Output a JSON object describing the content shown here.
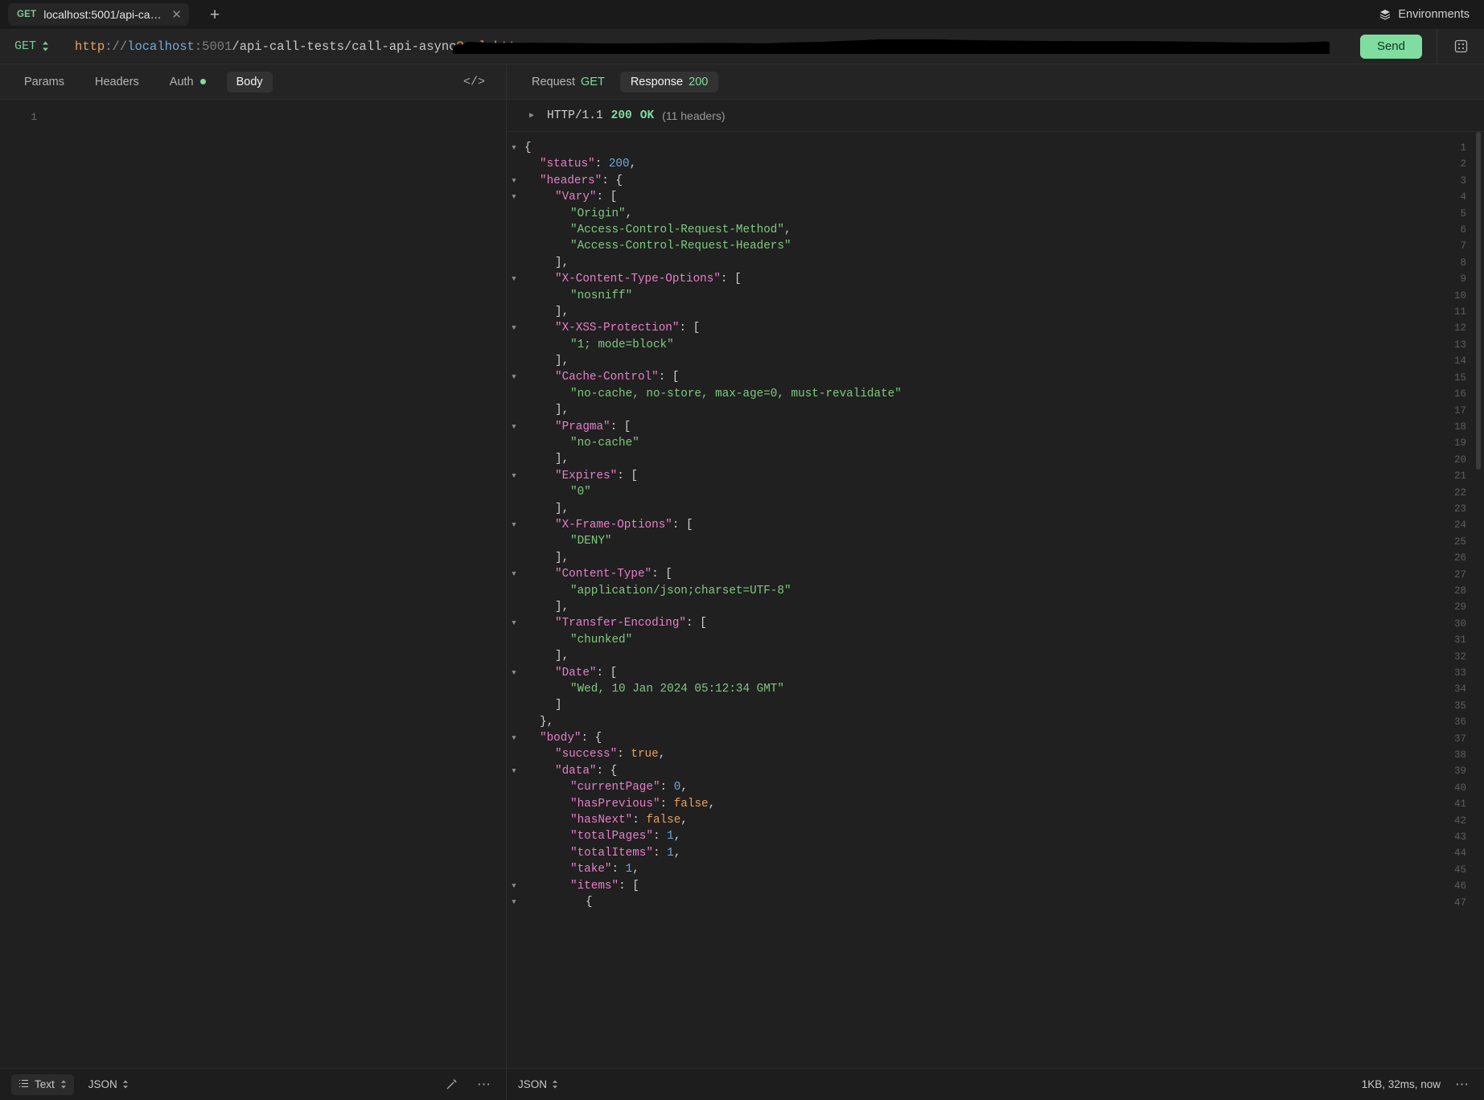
{
  "tabbar": {
    "request_tab": {
      "method": "GET",
      "name": "localhost:5001/api-cal…",
      "close_icon": "close-icon"
    },
    "new_tab_label": "+",
    "environments_label": "Environments"
  },
  "urlbar": {
    "method": "GET",
    "url_scheme": "http",
    "url_sep": "://",
    "url_host": "localhost",
    "url_colon": ":",
    "url_port": "5001",
    "url_path": "/api-call-tests/call-api-async",
    "url_query_mark": "?",
    "url_query_key": "url=",
    "url_query_value_visible": "http",
    "url_full": "http://localhost:5001/api-call-tests/call-api-async?url=http[redacted]",
    "send_label": "Send",
    "code_icon": "code-generate-icon"
  },
  "request_pane": {
    "tabs": [
      {
        "label": "Params",
        "active": false,
        "dot": false
      },
      {
        "label": "Headers",
        "active": false,
        "dot": false
      },
      {
        "label": "Auth",
        "active": false,
        "dot": true
      },
      {
        "label": "Body",
        "active": true,
        "dot": false
      }
    ],
    "code_icon_label": "</>",
    "editor_line_number": "1",
    "editor_content": ""
  },
  "response_pane": {
    "tabs": [
      {
        "label": "Request",
        "badge": "GET",
        "active": false
      },
      {
        "label": "Response",
        "badge": "200",
        "active": true
      }
    ],
    "status": {
      "twisty": "▶",
      "protocol": "HTTP/1.1",
      "code": "200",
      "text": "OK",
      "headers_count": "(11 headers)"
    }
  },
  "json_lines": [
    {
      "n": 1,
      "tw": "▼",
      "indent": 0,
      "parts": [
        {
          "t": "p",
          "v": "{"
        }
      ]
    },
    {
      "n": 2,
      "tw": "",
      "indent": 1,
      "parts": [
        {
          "t": "k",
          "v": "\"status\""
        },
        {
          "t": "p",
          "v": ": "
        },
        {
          "t": "n",
          "v": "200"
        },
        {
          "t": "p",
          "v": ","
        }
      ]
    },
    {
      "n": 3,
      "tw": "▼",
      "indent": 1,
      "parts": [
        {
          "t": "k",
          "v": "\"headers\""
        },
        {
          "t": "p",
          "v": ": {"
        }
      ]
    },
    {
      "n": 4,
      "tw": "▼",
      "indent": 2,
      "parts": [
        {
          "t": "k",
          "v": "\"Vary\""
        },
        {
          "t": "p",
          "v": ": ["
        }
      ]
    },
    {
      "n": 5,
      "tw": "",
      "indent": 3,
      "parts": [
        {
          "t": "s",
          "v": "\"Origin\""
        },
        {
          "t": "p",
          "v": ","
        }
      ]
    },
    {
      "n": 6,
      "tw": "",
      "indent": 3,
      "parts": [
        {
          "t": "s",
          "v": "\"Access-Control-Request-Method\""
        },
        {
          "t": "p",
          "v": ","
        }
      ]
    },
    {
      "n": 7,
      "tw": "",
      "indent": 3,
      "parts": [
        {
          "t": "s",
          "v": "\"Access-Control-Request-Headers\""
        }
      ]
    },
    {
      "n": 8,
      "tw": "",
      "indent": 2,
      "parts": [
        {
          "t": "p",
          "v": "],"
        }
      ]
    },
    {
      "n": 9,
      "tw": "▼",
      "indent": 2,
      "parts": [
        {
          "t": "k",
          "v": "\"X-Content-Type-Options\""
        },
        {
          "t": "p",
          "v": ": ["
        }
      ]
    },
    {
      "n": 10,
      "tw": "",
      "indent": 3,
      "parts": [
        {
          "t": "s",
          "v": "\"nosniff\""
        }
      ]
    },
    {
      "n": 11,
      "tw": "",
      "indent": 2,
      "parts": [
        {
          "t": "p",
          "v": "],"
        }
      ]
    },
    {
      "n": 12,
      "tw": "▼",
      "indent": 2,
      "parts": [
        {
          "t": "k",
          "v": "\"X-XSS-Protection\""
        },
        {
          "t": "p",
          "v": ": ["
        }
      ]
    },
    {
      "n": 13,
      "tw": "",
      "indent": 3,
      "parts": [
        {
          "t": "s",
          "v": "\"1; mode=block\""
        }
      ]
    },
    {
      "n": 14,
      "tw": "",
      "indent": 2,
      "parts": [
        {
          "t": "p",
          "v": "],"
        }
      ]
    },
    {
      "n": 15,
      "tw": "▼",
      "indent": 2,
      "parts": [
        {
          "t": "k",
          "v": "\"Cache-Control\""
        },
        {
          "t": "p",
          "v": ": ["
        }
      ]
    },
    {
      "n": 16,
      "tw": "",
      "indent": 3,
      "parts": [
        {
          "t": "s",
          "v": "\"no-cache, no-store, max-age=0, must-revalidate\""
        }
      ]
    },
    {
      "n": 17,
      "tw": "",
      "indent": 2,
      "parts": [
        {
          "t": "p",
          "v": "],"
        }
      ]
    },
    {
      "n": 18,
      "tw": "▼",
      "indent": 2,
      "parts": [
        {
          "t": "k",
          "v": "\"Pragma\""
        },
        {
          "t": "p",
          "v": ": ["
        }
      ]
    },
    {
      "n": 19,
      "tw": "",
      "indent": 3,
      "parts": [
        {
          "t": "s",
          "v": "\"no-cache\""
        }
      ]
    },
    {
      "n": 20,
      "tw": "",
      "indent": 2,
      "parts": [
        {
          "t": "p",
          "v": "],"
        }
      ]
    },
    {
      "n": 21,
      "tw": "▼",
      "indent": 2,
      "parts": [
        {
          "t": "k",
          "v": "\"Expires\""
        },
        {
          "t": "p",
          "v": ": ["
        }
      ]
    },
    {
      "n": 22,
      "tw": "",
      "indent": 3,
      "parts": [
        {
          "t": "s",
          "v": "\"0\""
        }
      ]
    },
    {
      "n": 23,
      "tw": "",
      "indent": 2,
      "parts": [
        {
          "t": "p",
          "v": "],"
        }
      ]
    },
    {
      "n": 24,
      "tw": "▼",
      "indent": 2,
      "parts": [
        {
          "t": "k",
          "v": "\"X-Frame-Options\""
        },
        {
          "t": "p",
          "v": ": ["
        }
      ]
    },
    {
      "n": 25,
      "tw": "",
      "indent": 3,
      "parts": [
        {
          "t": "s",
          "v": "\"DENY\""
        }
      ]
    },
    {
      "n": 26,
      "tw": "",
      "indent": 2,
      "parts": [
        {
          "t": "p",
          "v": "],"
        }
      ]
    },
    {
      "n": 27,
      "tw": "▼",
      "indent": 2,
      "parts": [
        {
          "t": "k",
          "v": "\"Content-Type\""
        },
        {
          "t": "p",
          "v": ": ["
        }
      ]
    },
    {
      "n": 28,
      "tw": "",
      "indent": 3,
      "parts": [
        {
          "t": "s",
          "v": "\"application/json;charset=UTF-8\""
        }
      ]
    },
    {
      "n": 29,
      "tw": "",
      "indent": 2,
      "parts": [
        {
          "t": "p",
          "v": "],"
        }
      ]
    },
    {
      "n": 30,
      "tw": "▼",
      "indent": 2,
      "parts": [
        {
          "t": "k",
          "v": "\"Transfer-Encoding\""
        },
        {
          "t": "p",
          "v": ": ["
        }
      ]
    },
    {
      "n": 31,
      "tw": "",
      "indent": 3,
      "parts": [
        {
          "t": "s",
          "v": "\"chunked\""
        }
      ]
    },
    {
      "n": 32,
      "tw": "",
      "indent": 2,
      "parts": [
        {
          "t": "p",
          "v": "],"
        }
      ]
    },
    {
      "n": 33,
      "tw": "▼",
      "indent": 2,
      "parts": [
        {
          "t": "k",
          "v": "\"Date\""
        },
        {
          "t": "p",
          "v": ": ["
        }
      ]
    },
    {
      "n": 34,
      "tw": "",
      "indent": 3,
      "parts": [
        {
          "t": "s",
          "v": "\"Wed, 10 Jan 2024 05:12:34 GMT\""
        }
      ]
    },
    {
      "n": 35,
      "tw": "",
      "indent": 2,
      "parts": [
        {
          "t": "p",
          "v": "]"
        }
      ]
    },
    {
      "n": 36,
      "tw": "",
      "indent": 1,
      "parts": [
        {
          "t": "p",
          "v": "},"
        }
      ]
    },
    {
      "n": 37,
      "tw": "▼",
      "indent": 1,
      "parts": [
        {
          "t": "k",
          "v": "\"body\""
        },
        {
          "t": "p",
          "v": ": {"
        }
      ]
    },
    {
      "n": 38,
      "tw": "",
      "indent": 2,
      "parts": [
        {
          "t": "k",
          "v": "\"success\""
        },
        {
          "t": "p",
          "v": ": "
        },
        {
          "t": "b",
          "v": "true"
        },
        {
          "t": "p",
          "v": ","
        }
      ]
    },
    {
      "n": 39,
      "tw": "▼",
      "indent": 2,
      "parts": [
        {
          "t": "k",
          "v": "\"data\""
        },
        {
          "t": "p",
          "v": ": {"
        }
      ]
    },
    {
      "n": 40,
      "tw": "",
      "indent": 3,
      "parts": [
        {
          "t": "k",
          "v": "\"currentPage\""
        },
        {
          "t": "p",
          "v": ": "
        },
        {
          "t": "n",
          "v": "0"
        },
        {
          "t": "p",
          "v": ","
        }
      ]
    },
    {
      "n": 41,
      "tw": "",
      "indent": 3,
      "parts": [
        {
          "t": "k",
          "v": "\"hasPrevious\""
        },
        {
          "t": "p",
          "v": ": "
        },
        {
          "t": "b",
          "v": "false"
        },
        {
          "t": "p",
          "v": ","
        }
      ]
    },
    {
      "n": 42,
      "tw": "",
      "indent": 3,
      "parts": [
        {
          "t": "k",
          "v": "\"hasNext\""
        },
        {
          "t": "p",
          "v": ": "
        },
        {
          "t": "b",
          "v": "false"
        },
        {
          "t": "p",
          "v": ","
        }
      ]
    },
    {
      "n": 43,
      "tw": "",
      "indent": 3,
      "parts": [
        {
          "t": "k",
          "v": "\"totalPages\""
        },
        {
          "t": "p",
          "v": ": "
        },
        {
          "t": "n",
          "v": "1"
        },
        {
          "t": "p",
          "v": ","
        }
      ]
    },
    {
      "n": 44,
      "tw": "",
      "indent": 3,
      "parts": [
        {
          "t": "k",
          "v": "\"totalItems\""
        },
        {
          "t": "p",
          "v": ": "
        },
        {
          "t": "n",
          "v": "1"
        },
        {
          "t": "p",
          "v": ","
        }
      ]
    },
    {
      "n": 45,
      "tw": "",
      "indent": 3,
      "parts": [
        {
          "t": "k",
          "v": "\"take\""
        },
        {
          "t": "p",
          "v": ": "
        },
        {
          "t": "n",
          "v": "1"
        },
        {
          "t": "p",
          "v": ","
        }
      ]
    },
    {
      "n": 46,
      "tw": "▼",
      "indent": 3,
      "parts": [
        {
          "t": "k",
          "v": "\"items\""
        },
        {
          "t": "p",
          "v": ": ["
        }
      ]
    },
    {
      "n": 47,
      "tw": "▼",
      "indent": 4,
      "parts": [
        {
          "t": "p",
          "v": "{"
        }
      ]
    }
  ],
  "bottombar": {
    "view_mode": "Text",
    "format_left": "JSON",
    "format_right": "JSON",
    "wand_icon": "magic-wand-icon",
    "more_icon": "more-options-icon",
    "response_meta": "1KB, 32ms, now"
  }
}
